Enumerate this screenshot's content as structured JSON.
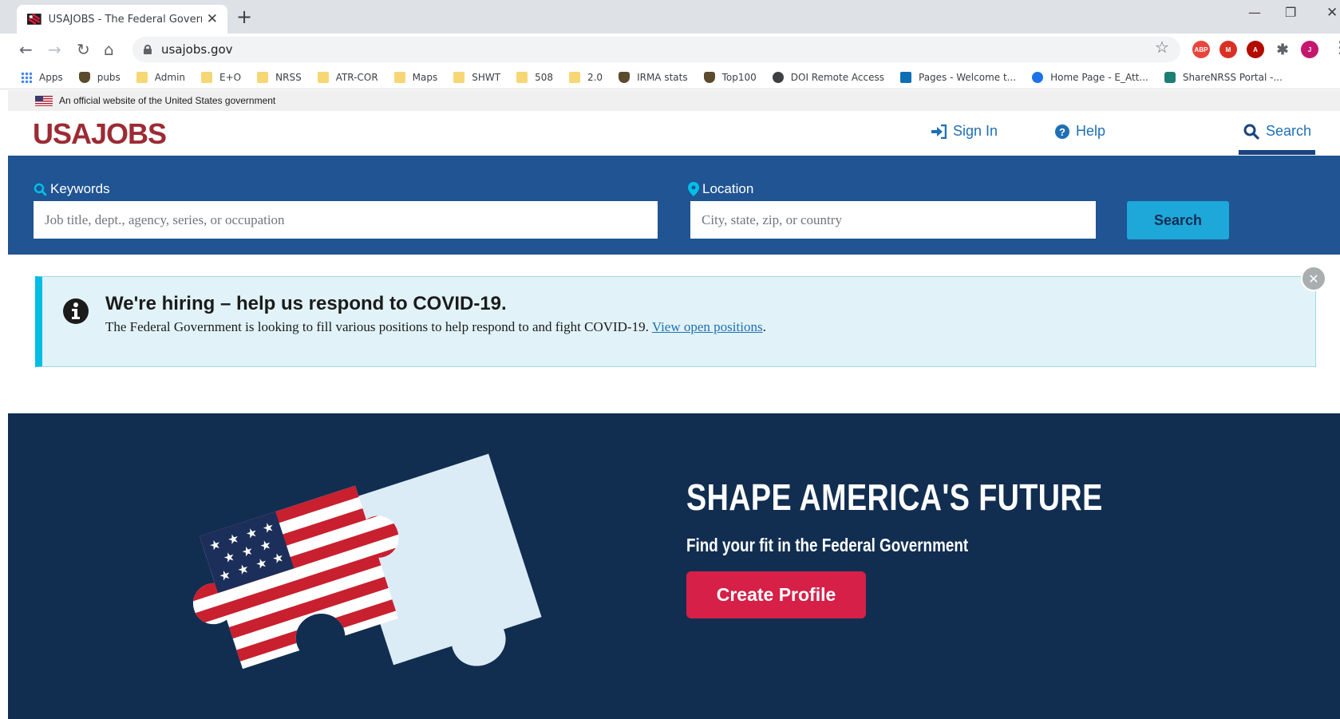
{
  "browser": {
    "tab_title": "USAJOBS - The Federal Governm",
    "tab_close": "✕",
    "new_tab": "+",
    "url": "usajobs.gov",
    "bookmarks": [
      {
        "label": "Apps",
        "icon": "apps-grid-icon"
      },
      {
        "label": "pubs",
        "icon": "badge-icon"
      },
      {
        "label": "Admin",
        "icon": "folder-icon"
      },
      {
        "label": "E+O",
        "icon": "folder-icon"
      },
      {
        "label": "NRSS",
        "icon": "folder-icon"
      },
      {
        "label": "ATR-COR",
        "icon": "folder-icon"
      },
      {
        "label": "Maps",
        "icon": "folder-icon"
      },
      {
        "label": "SHWT",
        "icon": "folder-icon"
      },
      {
        "label": "508",
        "icon": "folder-icon"
      },
      {
        "label": "2.0",
        "icon": "folder-icon"
      },
      {
        "label": "IRMA stats",
        "icon": "badge-icon"
      },
      {
        "label": "Top100",
        "icon": "badge-icon"
      },
      {
        "label": "DOI Remote Access",
        "icon": "globe-icon"
      },
      {
        "label": "Pages - Welcome t...",
        "icon": "sharepoint-icon"
      },
      {
        "label": "Home Page - E_Att...",
        "icon": "play-icon"
      },
      {
        "label": "ShareNRSS Portal -...",
        "icon": "share-icon"
      }
    ],
    "extensions": [
      {
        "name": "adblock-icon",
        "color": "#e8453c",
        "text": "ABP"
      },
      {
        "name": "gmail-icon",
        "color": "#d93025",
        "text": "M"
      },
      {
        "name": "pdf-icon",
        "color": "#b30b00",
        "text": "A"
      },
      {
        "name": "puzzle-extension-icon",
        "color": "#5f6368",
        "text": ""
      },
      {
        "name": "profile-avatar",
        "color": "#c5166e",
        "text": "J"
      }
    ]
  },
  "gov_banner": "An official website of the United States government",
  "header": {
    "logo": "USAJOBS",
    "sign_in": "Sign In",
    "help": "Help",
    "search": "Search"
  },
  "search": {
    "keywords_label": "Keywords",
    "keywords_placeholder": "Job title, dept., agency, series, or occupation",
    "location_label": "Location",
    "location_placeholder": "City, state, zip, or country",
    "button": "Search"
  },
  "alert": {
    "title": "We're hiring – help us respond to COVID-19.",
    "body": "The Federal Government is looking to fill various positions to help respond to and fight COVID-19.",
    "link": "View open positions",
    "after_link": ".",
    "close": "✕"
  },
  "hero": {
    "title": "SHAPE AMERICA'S FUTURE",
    "subtitle": "Find your fit in the Federal Government",
    "cta": "Create Profile"
  },
  "colors": {
    "brand_red": "#9c2b34",
    "search_bar_blue": "#205493",
    "hero_navy": "#112e51",
    "search_button": "#1ea7d9",
    "cta_red": "#d62048",
    "alert_bg": "#e1f3f8",
    "link_blue": "#1f6fb5"
  }
}
